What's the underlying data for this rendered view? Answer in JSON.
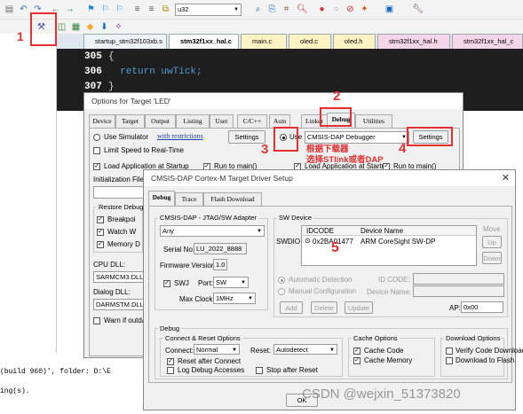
{
  "toolbar": {
    "target_combo": "u32",
    "icons": [
      "new-file-icon",
      "open-icon",
      "save-icon",
      "cut-icon",
      "copy-icon",
      "paste-icon",
      "undo-icon",
      "redo-icon",
      "back-icon",
      "forward-icon",
      "bookmark-icon",
      "find-icon",
      "find-in-files-icon",
      "zoom-icon",
      "breakpoint-icon",
      "debug-icon",
      "erase-icon",
      "window-icon",
      "wrench-icon",
      "magic-wand-icon",
      "options-target-icon",
      "translate-icon",
      "build-icon",
      "rebuild-icon",
      "download-icon"
    ]
  },
  "file_tabs": [
    "startup_stm32f103xb.s",
    "stm32f1xx_hal.c",
    "main.c",
    "oled.c",
    "oled.h",
    "stm32f1xx_hal.h",
    "stm32f1xx_hal_c"
  ],
  "code": {
    "lines": [
      {
        "num": "305",
        "text": "{"
      },
      {
        "num": "306",
        "text": "  return uwTick;"
      },
      {
        "num": "307",
        "text": "}"
      }
    ]
  },
  "output": {
    "line1": "(build 960)', folder: D:\\E",
    "line2": "ing(s)."
  },
  "options_dialog": {
    "title": "Options for Target 'LED'",
    "tabs": [
      "Device",
      "Target",
      "Output",
      "Listing",
      "User",
      "C/C++",
      "Asm",
      "Linker",
      "Debug",
      "Utilities"
    ],
    "use_simulator": "Use Simulator",
    "with_restrictions": "with restrictions",
    "settings_left": "Settings",
    "limit_speed": "Limit Speed to Real-Time",
    "use": "Use",
    "debugger": "CMSIS-DAP Debugger",
    "settings_right": "Settings",
    "load_app_left": "Load Application at Startup",
    "run_to_main_left": "Run to main()",
    "load_app_right": "Load Application at Startup",
    "run_to_main_right": "Run to main()",
    "init_file": "Initialization File:",
    "restore_debug": "Restore Debug",
    "breakpoints": "Breakpoi",
    "watch": "Watch W",
    "memory": "Memory D",
    "cpu_dll_label": "CPU DLL:",
    "cpu_dll_value": "SARMCM3.DLL",
    "dialog_dll_label": "Dialog DLL:",
    "dialog_dll_value": "DARMSTM.DLL",
    "warn_outdated": "Warn if outda"
  },
  "cmsis_dialog": {
    "title": "CMSIS-DAP Cortex-M Target Driver Setup",
    "tabs": [
      "Debug",
      "Trace",
      "Flash Download"
    ],
    "adapter_group": "CMSIS-DAP - JTAG/SW Adapter",
    "adapter_value": "Any",
    "serial_label": "Serial No:",
    "serial_value": "LU_2022_8888",
    "firmware_label": "Firmware Version:",
    "firmware_value": "1.0",
    "swj": "SWJ",
    "port_label": "Port:",
    "port_value": "SW",
    "max_clock_label": "Max Clock:",
    "max_clock_value": "1MHz",
    "sw_device_group": "SW Device",
    "swdio": "SWDIO",
    "col_idcode": "IDCODE",
    "col_device": "Device Name",
    "row_idcode": "0x2BA01477",
    "row_device": "ARM CoreSight SW-DP",
    "move": "Move",
    "up": "Up",
    "down": "Down",
    "auto_detect": "Automatic Detection",
    "manual_config": "Manual Configuration",
    "id_code_label": "ID CODE:",
    "device_name_label": "Device Name:",
    "add": "Add",
    "delete": "Delete",
    "update": "Update",
    "ap_label": "AP:",
    "ap_value": "0x00",
    "debug_group": "Debug",
    "connect_reset_group": "Connect & Reset Options",
    "connect_label": "Connect:",
    "connect_value": "Normal",
    "reset_label": "Reset:",
    "reset_value": "Autodetect",
    "reset_after_connect": "Reset after Connect",
    "log_debug": "Log Debug Accesses",
    "stop_after_reset": "Stop after Reset",
    "cache_group": "Cache Options",
    "cache_code": "Cache Code",
    "cache_memory": "Cache Memory",
    "download_group": "Download Options",
    "verify_code": "Verify Code Download",
    "download_flash": "Download to Flash",
    "ok": "OK"
  },
  "annotations": {
    "n1": "1",
    "n2": "2",
    "n3": "3",
    "n4": "4",
    "n5": "5",
    "note1": "根据下载器",
    "note2": "选择STlink或者DAP"
  },
  "watermark": "CSDN @wejxin_51373820",
  "colors": {
    "annotation_red": "#e53030",
    "editor_bg": "#1e1e1e",
    "code_blue": "#569cd6"
  }
}
